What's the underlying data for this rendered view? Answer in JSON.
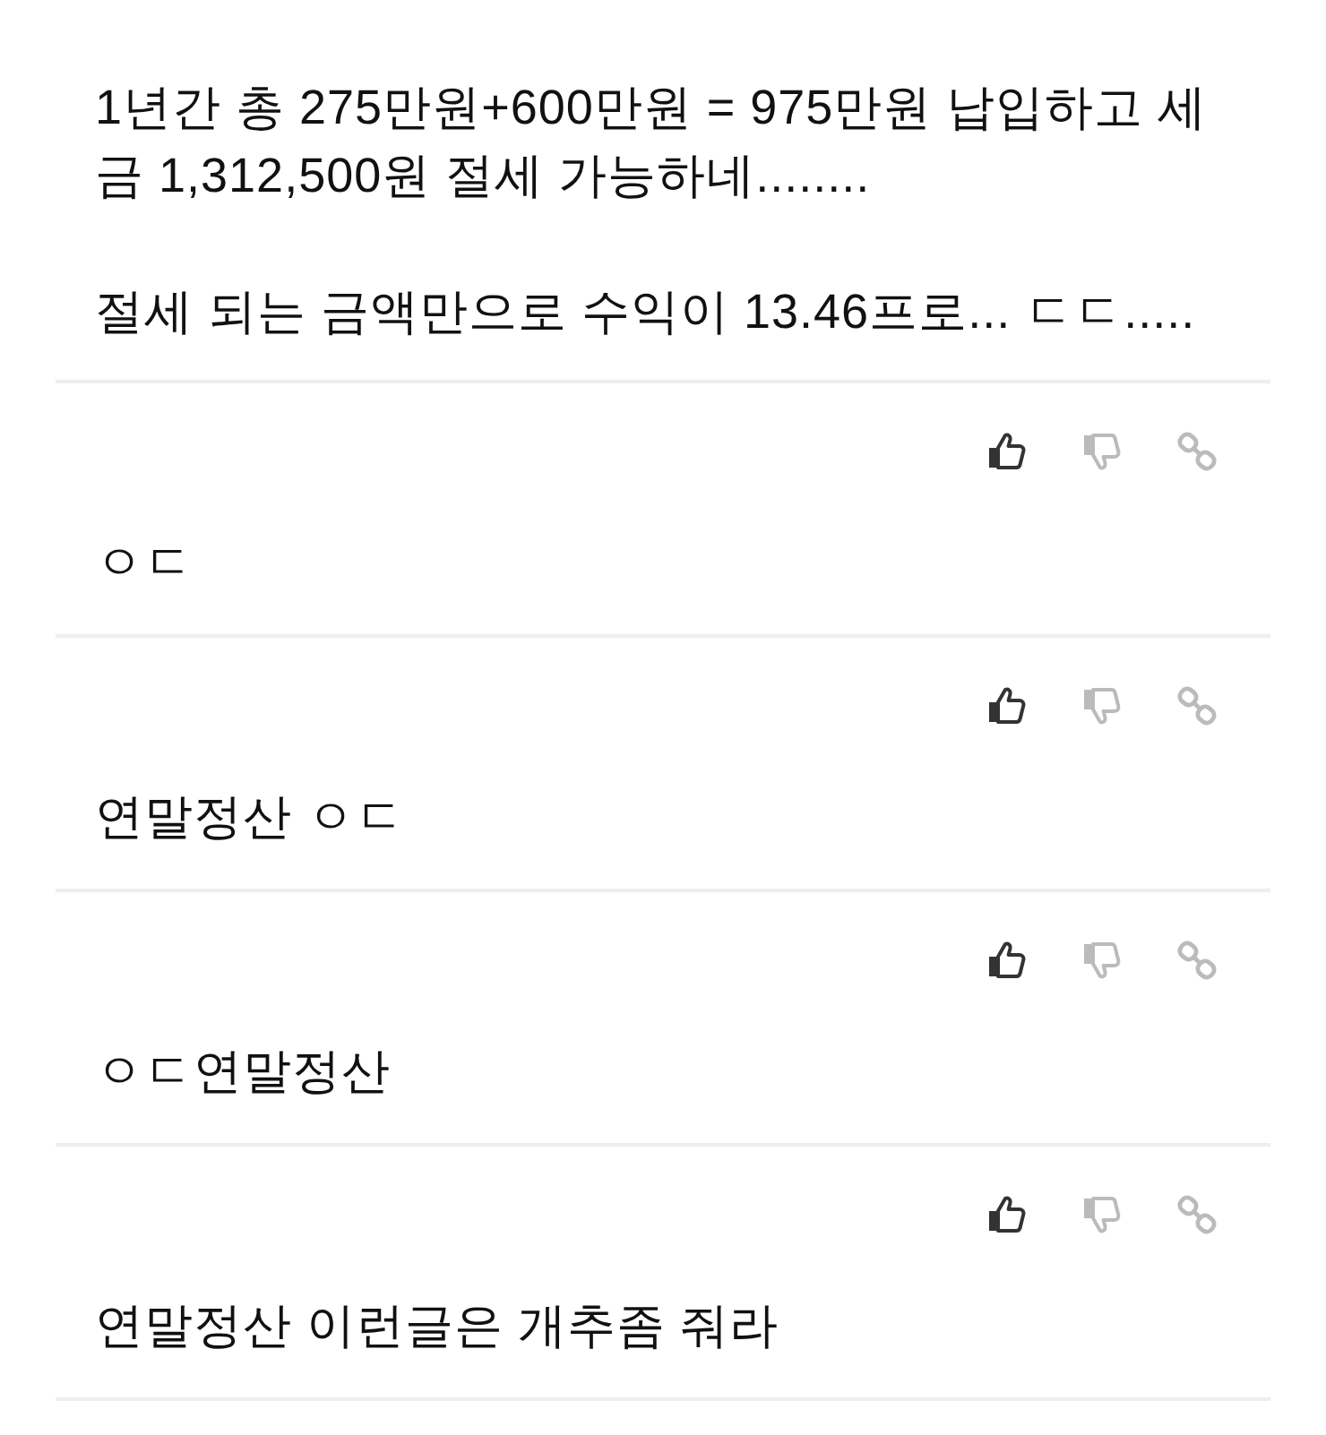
{
  "post_excerpt": {
    "text": "1년간 총 275만원+600만원 = 975만원 납입하고 세금 1,312,500원 절세 가능하네........\n\n절세 되는 금액만으로 수익이 13.46프로... ㄷㄷ....."
  },
  "comments": [
    {
      "text": "ㅇㄷ"
    },
    {
      "text": "연말정산 ㅇㄷ"
    },
    {
      "text": "ㅇㄷ연말정산"
    },
    {
      "text": "연말정산 이런글은 개추좀 줘라"
    }
  ]
}
